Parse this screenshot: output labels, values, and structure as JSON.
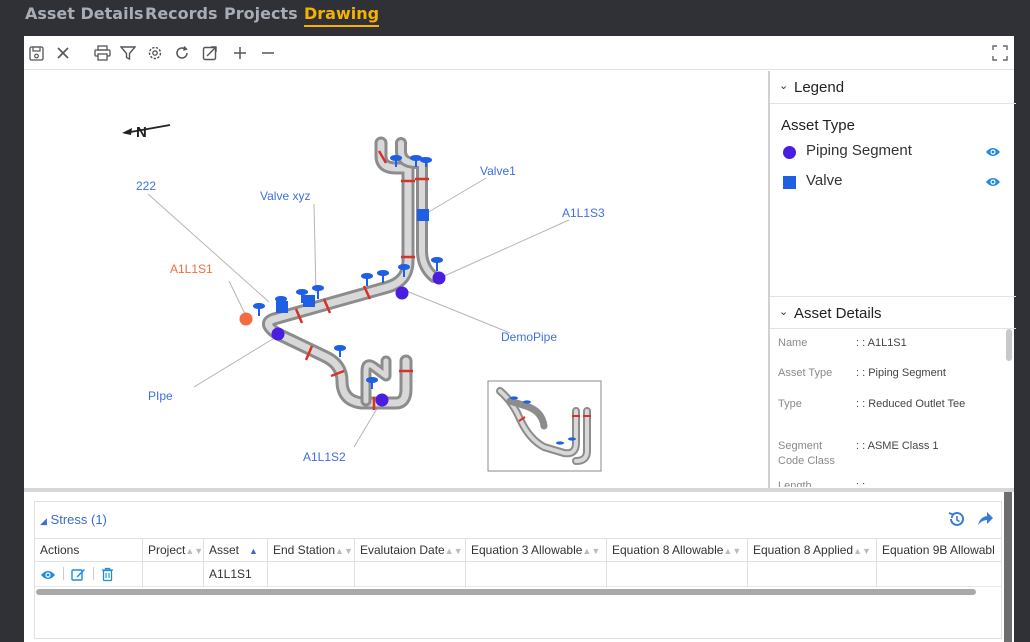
{
  "nav": {
    "tabs": [
      {
        "label": "Asset Details"
      },
      {
        "label": "Records"
      },
      {
        "label": "Projects"
      },
      {
        "label": "Drawing"
      }
    ]
  },
  "drawing": {
    "north": "N",
    "labels": {
      "l222": "222",
      "valve_xyz": "Valve xyz",
      "valve1": "Valve1",
      "a1l1s3": "A1L1S3",
      "a1l1s1": "A1L1S1",
      "demopipe": "DemoPipe",
      "pipe": "PIpe",
      "a1l1s2": "A1L1S2"
    }
  },
  "legend": {
    "title": "Legend",
    "asset_type_label": "Asset Type",
    "items": [
      {
        "name": "Piping Segment",
        "color": "#4a1de0",
        "icon": "circle-icon"
      },
      {
        "name": "Valve",
        "color": "#1f5fe6",
        "icon": "square-icon"
      }
    ]
  },
  "asset_details": {
    "title": "Asset Details",
    "rows": [
      {
        "key": "Name",
        "value": ": : A1L1S1"
      },
      {
        "key": "Asset Type",
        "value": ": : Piping Segment"
      },
      {
        "key": "Type",
        "value": ": : Reduced Outlet Tee"
      },
      {
        "key": "Segment Code Class",
        "value": ": : ASME Class 1"
      },
      {
        "key": "Length",
        "value": ": :"
      }
    ]
  },
  "stress": {
    "title": "Stress (1)",
    "columns": [
      "Actions",
      "Project",
      "Asset",
      "End Station",
      "Evalutaion Date",
      "Equation 3 Allowable",
      "Equation 8 Allowable",
      "Equation 8 Applied",
      "Equation 9B Allowabl"
    ],
    "rows": [
      {
        "asset": "A1L1S1"
      }
    ]
  },
  "colors": {
    "accent": "#f5b200",
    "piping": "#4a1de0",
    "valve": "#1f5fe6",
    "highlight": "#f36b3f",
    "link": "#3f6fe0"
  }
}
